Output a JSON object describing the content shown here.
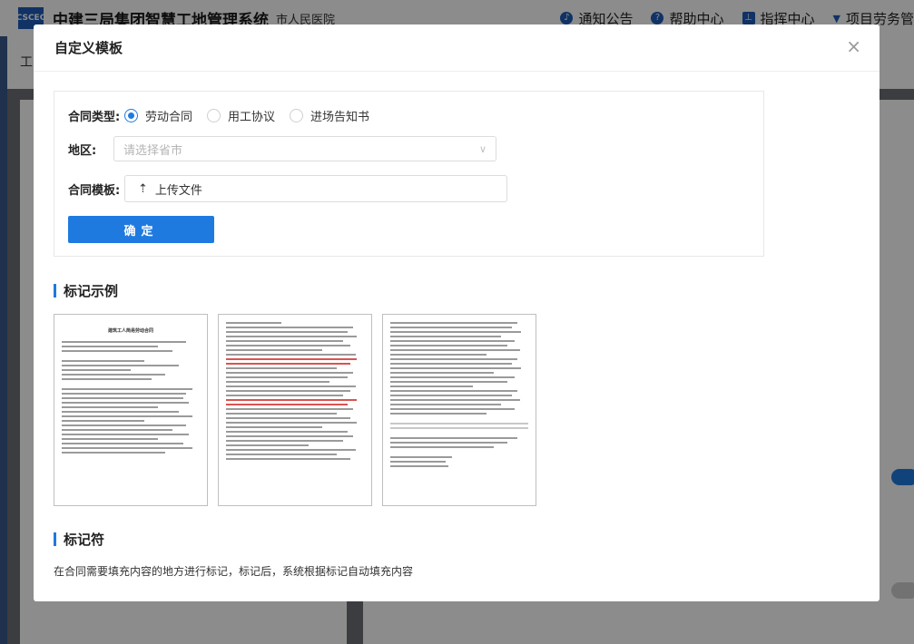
{
  "app": {
    "logo_text": "CSCEC",
    "title": "中建三局集团智慧工地管理系统",
    "project": "市人民医院",
    "header_links": [
      {
        "label": "通知公告",
        "icon": "bell-icon"
      },
      {
        "label": "帮助中心",
        "icon": "question-icon"
      },
      {
        "label": "指挥中心",
        "icon": "org-chart-icon"
      },
      {
        "label": "项目劳务管",
        "icon": "caret-down-icon"
      }
    ],
    "sub_text": "工"
  },
  "modal": {
    "title": "自定义模板",
    "close_glyph": "×",
    "form": {
      "contract_type_label": "合同类型:",
      "contract_types": [
        {
          "label": "劳动合同",
          "checked": true
        },
        {
          "label": "用工协议",
          "checked": false
        },
        {
          "label": "进场告知书",
          "checked": false
        }
      ],
      "region_label": "地区:",
      "region_placeholder": "请选择省市",
      "template_label": "合同模板:",
      "upload_label": "上传文件",
      "confirm_label": "确定"
    },
    "example_section_title": "标记示例",
    "example_doc_title": "建筑工人简易劳动合同",
    "marker_section_title": "标记符",
    "marker_description": "在合同需要填充内容的地方进行标记，标记后，系统根据标记自动填充内容"
  },
  "colors": {
    "primary": "#1f7ae0",
    "overlay": "rgba(0,0,0,0.45)",
    "marker_red": "#d9534f"
  }
}
